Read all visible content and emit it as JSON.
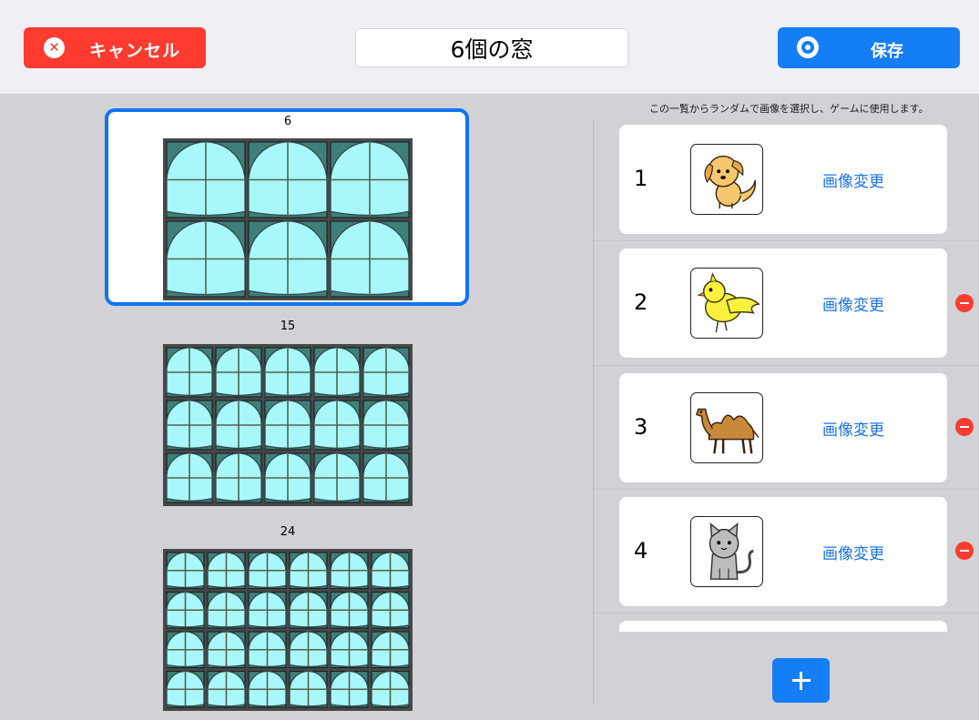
{
  "header": {
    "cancel_label": "キャンセル",
    "cancel_icon": "close-circle-icon",
    "title_value": "6個の窓",
    "save_label": "保存",
    "save_icon": "record-circle-icon"
  },
  "layouts": [
    {
      "label": "6",
      "rows": 2,
      "cols": 3,
      "selected": true
    },
    {
      "label": "15",
      "rows": 3,
      "cols": 5,
      "selected": false
    },
    {
      "label": "24",
      "rows": 4,
      "cols": 6,
      "selected": false
    }
  ],
  "image_list": {
    "hint": "この一覧からランダムで画像を選択し、ゲームに使用します。",
    "change_label": "画像変更",
    "items": [
      {
        "number": "1",
        "image": "dog-icon",
        "deletable": false
      },
      {
        "number": "2",
        "image": "bird-icon",
        "deletable": true
      },
      {
        "number": "3",
        "image": "camel-icon",
        "deletable": true
      },
      {
        "number": "4",
        "image": "cat-icon",
        "deletable": true
      }
    ],
    "add_icon": "plus-icon",
    "delete_icon": "minus-circle-icon"
  },
  "colors": {
    "cancel": "#ff3b30",
    "save": "#147ef6",
    "selected_border": "#0f74f5",
    "window_glass": "#a8f8fb",
    "window_frame": "#2e4b48",
    "link": "#1a73e8"
  }
}
